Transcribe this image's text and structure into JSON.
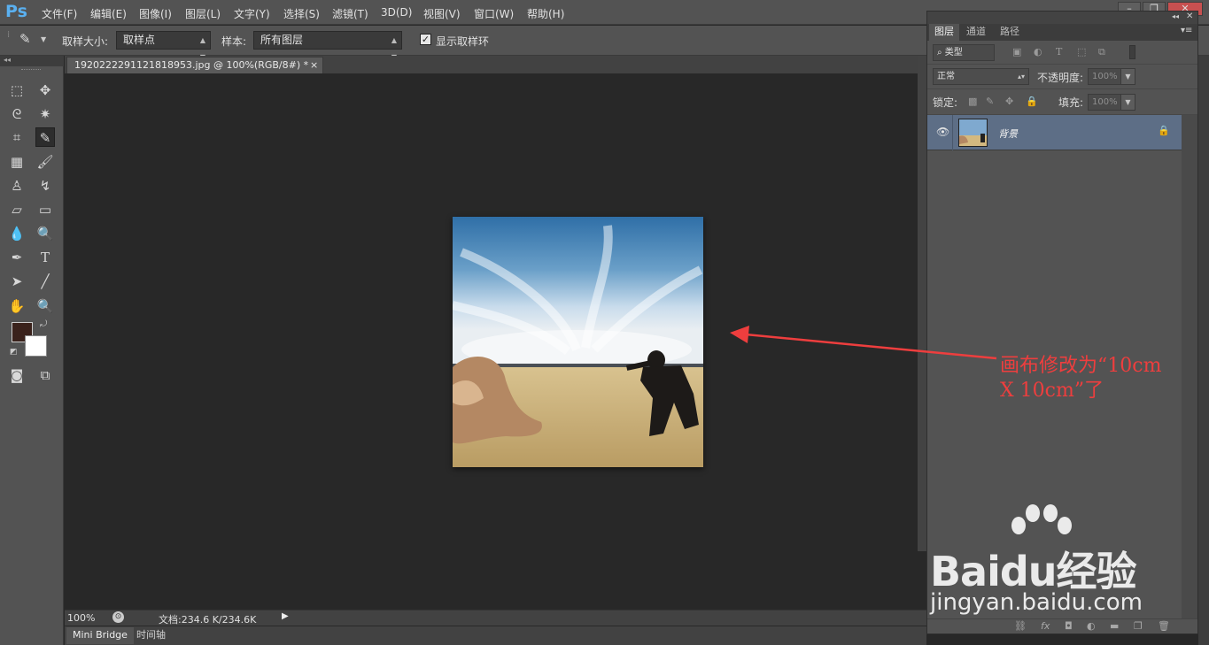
{
  "app": {
    "logo": "Ps"
  },
  "menu": [
    "文件(F)",
    "编辑(E)",
    "图像(I)",
    "图层(L)",
    "文字(Y)",
    "选择(S)",
    "滤镜(T)",
    "3D(D)",
    "视图(V)",
    "窗口(W)",
    "帮助(H)"
  ],
  "options": {
    "sample_size_label": "取样大小:",
    "sample_size_value": "取样点",
    "sample_label": "样本:",
    "sample_value": "所有图层",
    "show_ring_label": "显示取样环",
    "show_ring_checked": true
  },
  "document": {
    "tab_title": "1920222291121818953.jpg @ 100%(RGB/8#) *",
    "tab_close": "×"
  },
  "status": {
    "zoom": "100%",
    "doc_info": "文档:234.6 K/234.6K"
  },
  "bottom_tabs": [
    "Mini Bridge",
    "时间轴"
  ],
  "layers_panel": {
    "tabs": [
      "图层",
      "通道",
      "路径"
    ],
    "filter_type": "类型",
    "blend_mode": "正常",
    "opacity_label": "不透明度:",
    "opacity_value": "100%",
    "lock_label": "锁定:",
    "fill_label": "填充:",
    "fill_value": "100%",
    "layer_name": "背景"
  },
  "annotation": {
    "text": "画布修改为“10cm\nX 10cm”了",
    "color": "#ee3e3e"
  },
  "watermark": {
    "main": "Baidu经验",
    "url": "jingyan.baidu.com"
  },
  "colors": {
    "foreground": "#3a221c",
    "background": "#ffffff",
    "selected_layer": "#5d6e86"
  }
}
